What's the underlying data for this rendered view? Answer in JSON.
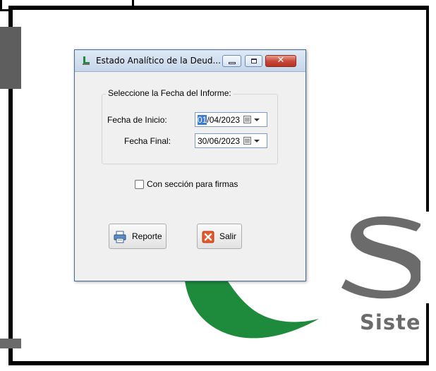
{
  "window": {
    "title": "Estado Analítico de la Deud...",
    "close_glyph": "✕"
  },
  "form": {
    "group_title": "Seleccione la Fecha del Informe:",
    "start_label": "Fecha de Inicio:",
    "start_value_selected": "01",
    "start_value_rest": "/04/2023",
    "end_label": "Fecha Final:",
    "end_value": "30/06/2023",
    "signature_checkbox_label": "Con sección para firmas",
    "signature_checked": false
  },
  "buttons": {
    "report_label": "Reporte",
    "exit_label": "Salir"
  },
  "background": {
    "brand_text": "Sisten"
  },
  "colors": {
    "logo_green": "#1e8a3c",
    "logo_gray": "#6b6b6b",
    "selection_blue": "#3b79d6"
  },
  "icons": [
    "app-icon",
    "minimize-icon",
    "maximize-icon",
    "close-icon",
    "calendar-icon",
    "printer-icon",
    "exit-icon"
  ]
}
